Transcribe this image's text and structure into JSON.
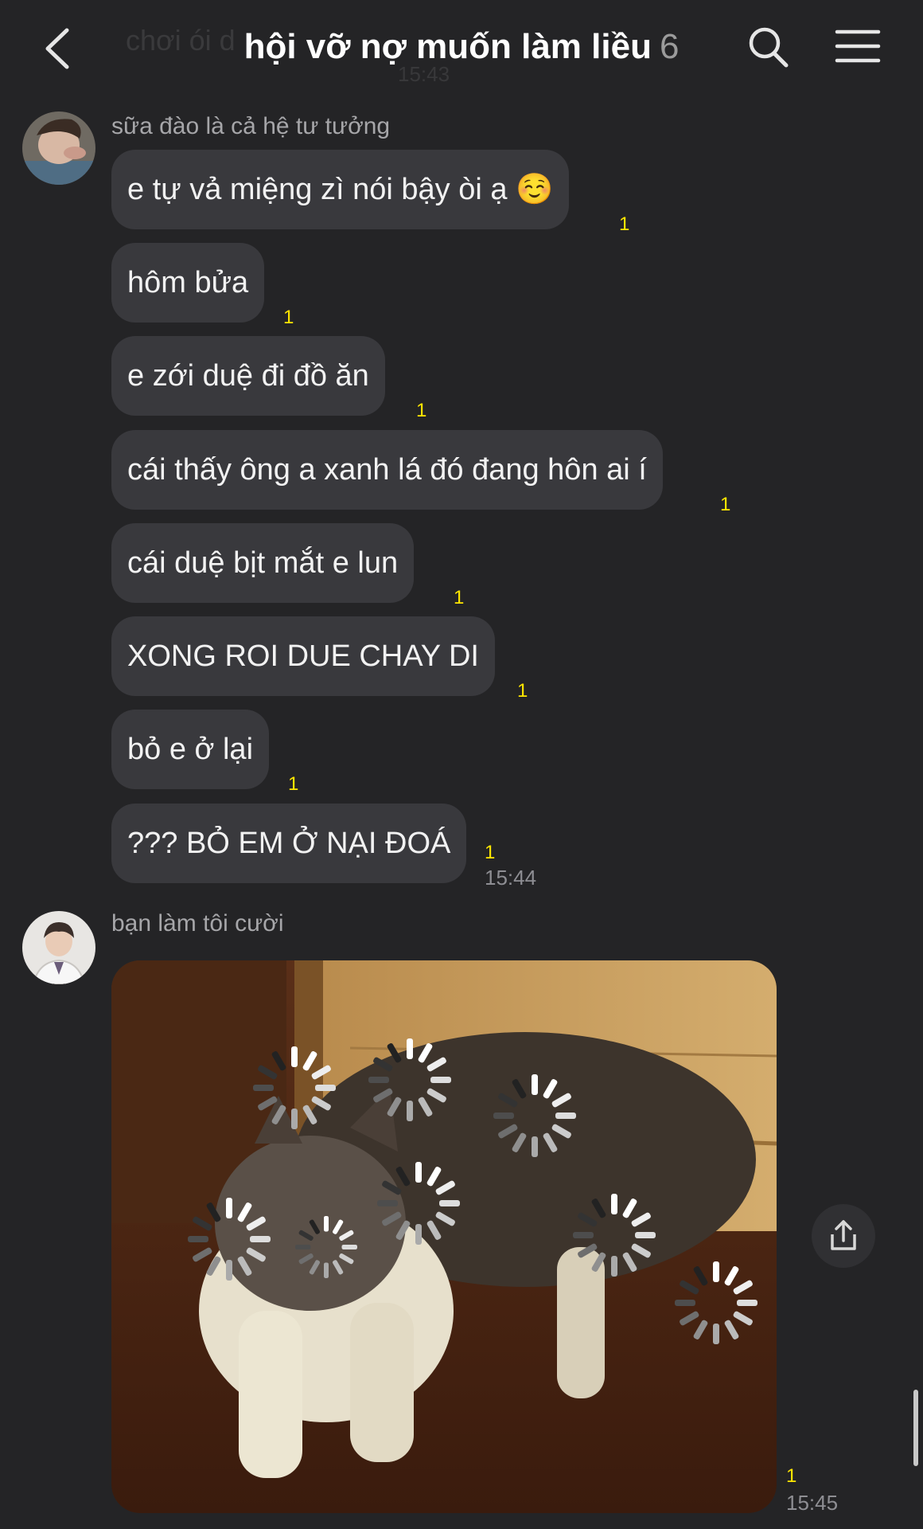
{
  "header": {
    "title": "hội vỡ nợ muốn làm liều",
    "member_count": "6",
    "background_text": "chơi ói d",
    "background_time": "15:43",
    "back_icon": "chevron-left-icon",
    "search_icon": "search-icon",
    "menu_icon": "hamburger-menu-icon"
  },
  "colors": {
    "background": "#242426",
    "bubble": "#39393d",
    "unread": "#ffe600",
    "secondary_text": "#a6a6a9"
  },
  "group1": {
    "sender": "sữa đào là cả hệ tư tưởng",
    "messages": [
      {
        "text": "e tự vả miệng zì nói bậy òi ạ ☺️",
        "unread": "1"
      },
      {
        "text": "hôm bửa",
        "unread": "1"
      },
      {
        "text": "e zới duệ đi đồ ăn",
        "unread": "1"
      },
      {
        "text": "cái thấy ông a xanh lá đó đang hôn ai í",
        "unread": "1"
      },
      {
        "text": "cái duệ bịt mắt e lun",
        "unread": "1"
      },
      {
        "text": "XONG ROI DUE CHAY DI",
        "unread": "1"
      },
      {
        "text": "bỏ e ở lại",
        "unread": "1"
      },
      {
        "text": "??? BỎ EM Ở NẠI ĐOÁ",
        "unread": "1"
      }
    ],
    "time": "15:44"
  },
  "group2": {
    "sender": "bạn làm tôi cười",
    "image_description_icon": "photo-icon",
    "unread": "1",
    "time": "15:45",
    "share_icon": "share-icon"
  }
}
